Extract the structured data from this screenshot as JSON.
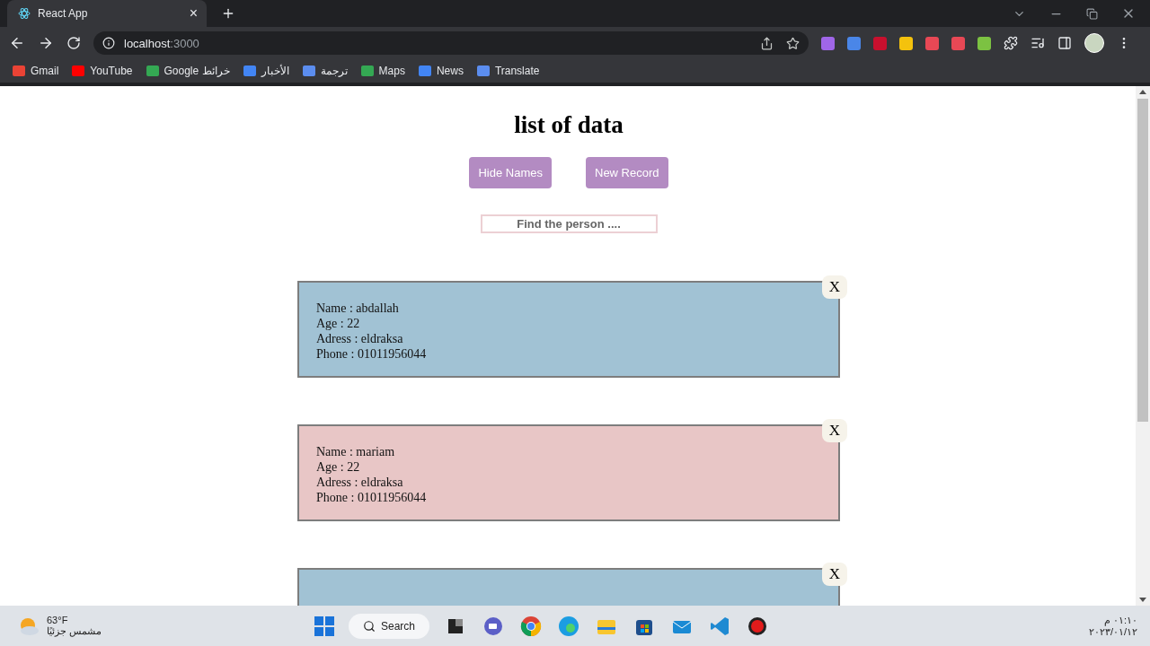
{
  "browser": {
    "tab": {
      "title": "React App",
      "close": "×"
    },
    "url_host": "localhost",
    "url_port": ":3000",
    "bookmarks": [
      {
        "label": "Gmail",
        "color": "#ea4335"
      },
      {
        "label": "YouTube",
        "color": "#ff0000"
      },
      {
        "label": "Google خرائط",
        "color": "#34a853"
      },
      {
        "label": "الأخبار",
        "color": "#4285f4"
      },
      {
        "label": "ترجمة",
        "color": "#5b8def"
      },
      {
        "label": "Maps",
        "color": "#34a853"
      },
      {
        "label": "News",
        "color": "#4285f4"
      },
      {
        "label": "Translate",
        "color": "#5b8def"
      }
    ],
    "extensions": [
      {
        "color": "#a066e8"
      },
      {
        "color": "#4a86e8"
      },
      {
        "color": "#c8102e"
      },
      {
        "color": "#f4c20d"
      },
      {
        "color": "#e84855"
      },
      {
        "color": "#e84855"
      },
      {
        "color": "#7cc242"
      }
    ]
  },
  "page": {
    "title": "list of data",
    "buttons": [
      "Hide Names",
      "New Record"
    ],
    "search": {
      "placeholder": "Find the person ...."
    },
    "records": [
      {
        "color": "#a1c2d4",
        "close": "X",
        "lines": [
          "Name : abdallah",
          "Age : 22",
          "Adress : eldraksa",
          "Phone : 01011956044"
        ]
      },
      {
        "color": "#e8c6c6",
        "close": "X",
        "lines": [
          "Name : mariam",
          "Age : 22",
          "Adress : eldraksa",
          "Phone : 01011956044"
        ]
      },
      {
        "color": "#a1c2d4",
        "close": "X"
      }
    ]
  },
  "taskbar": {
    "temperature": "63°F",
    "weather": "مشمس جزئيًا",
    "search": "Search",
    "time": "٠١:١٠ م",
    "date": "٢٠٢٣/٠١/١٢",
    "apps": [
      {
        "kind": "files"
      },
      {
        "kind": "chat"
      },
      {
        "kind": "chrome"
      },
      {
        "kind": "edge"
      },
      {
        "kind": "folder"
      },
      {
        "kind": "store"
      },
      {
        "kind": "mail"
      },
      {
        "kind": "vscode"
      },
      {
        "kind": "record"
      }
    ]
  }
}
